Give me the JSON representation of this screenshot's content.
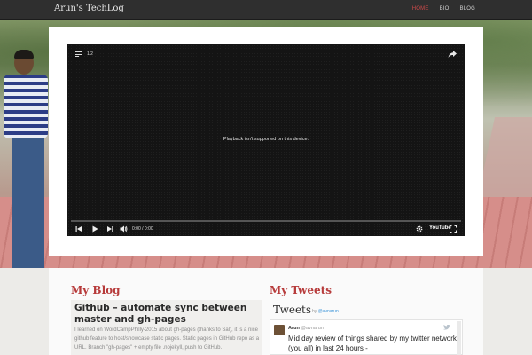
{
  "nav": {
    "brand": "Arun's TechLog",
    "links": [
      {
        "label": "HOME",
        "active": true
      },
      {
        "label": "BIO",
        "active": false
      },
      {
        "label": "BLOG",
        "active": false
      }
    ]
  },
  "video": {
    "playlist_count": "1/2",
    "message": "Playback isn't supported on this device.",
    "time": "0:00 / 0:00",
    "logo": "YouTube",
    "icons": [
      "playlist-icon",
      "share-icon",
      "previous-icon",
      "play-icon",
      "next-icon",
      "volume-icon",
      "settings-icon",
      "youtube-icon",
      "fullscreen-icon"
    ]
  },
  "blog": {
    "section_title": "My Blog",
    "post_title": "Github – automate sync between master and gh-pages",
    "post_excerpt": "I learned on WordCampPhilly-2015 about gh-pages (thanks to Sal), it is a nice github feature to host/showcase static pages. Static pages in GitHub repo as a URL. Branch \"gh-pages\" + empty file .nojekyll, push to GitHub."
  },
  "tweets": {
    "section_title": "My Tweets",
    "widget_title": "Tweets",
    "by_prefix": "by",
    "by_handle": "@avnarun",
    "tweet": {
      "name": "Arun",
      "handle": "@avnarun",
      "text": "Mid day review of things shared by my twitter network (you all) in last 24 hours -"
    }
  },
  "colors": {
    "accent": "#b73b3b",
    "nav_bg": "#2f2f2f",
    "link": "#3b94d9"
  }
}
